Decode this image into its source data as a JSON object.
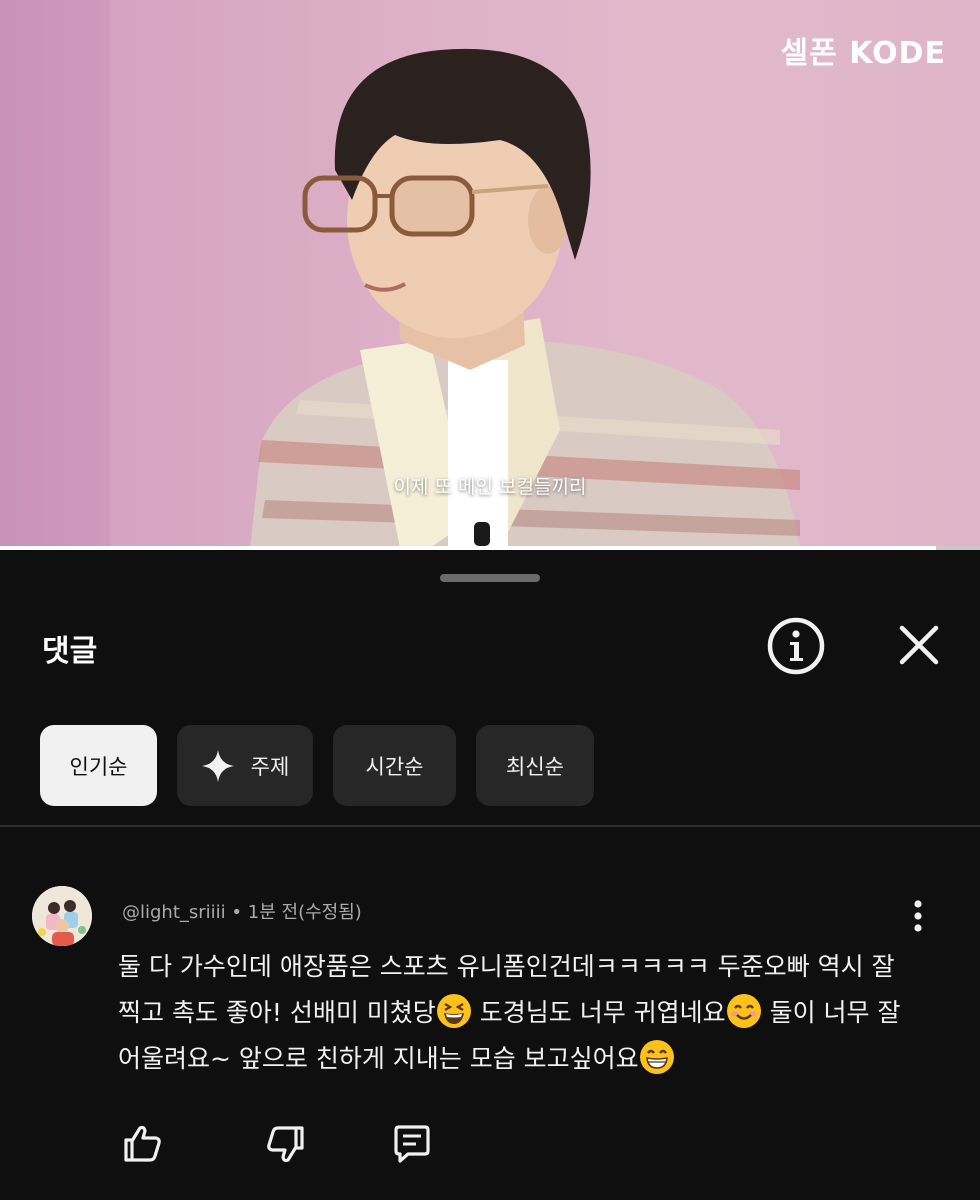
{
  "video": {
    "brand": "셀폰 KODE",
    "subtitle": "이제 또 메인 보컬들끼리",
    "progress_fraction": 0.955
  },
  "sheet": {
    "title": "댓글",
    "info_icon": "info-circle-icon",
    "close_icon": "close-icon",
    "sort_chips": [
      {
        "label": "인기순",
        "active": true
      },
      {
        "label": "주제",
        "icon": "sparkle-icon"
      },
      {
        "label": "시간순"
      },
      {
        "label": "최신순"
      }
    ]
  },
  "comment": {
    "author": "@light_sriiii",
    "time": "1분 전(수정됨)",
    "separator": "•",
    "text_1": "둘 다 가수인데 애장품은 스포츠 유니폼인건데ㅋㅋㅋㅋㅋ 두준오빠 역시 잘 찍고 촉도 좋아! 선배미 미쳤당",
    "text_2": " 도경님도 너무 귀엽네요",
    "text_3": " 둘이 너무 잘 어울려요~ 앞으로 친하게 지내는 모습 보고싶어요",
    "emojis": [
      "grinning-squinting-face",
      "smiling-face-with-smiling-eyes",
      "beaming-face-with-smiling-eyes"
    ],
    "actions": [
      "like-icon",
      "dislike-icon",
      "reply-icon"
    ]
  }
}
